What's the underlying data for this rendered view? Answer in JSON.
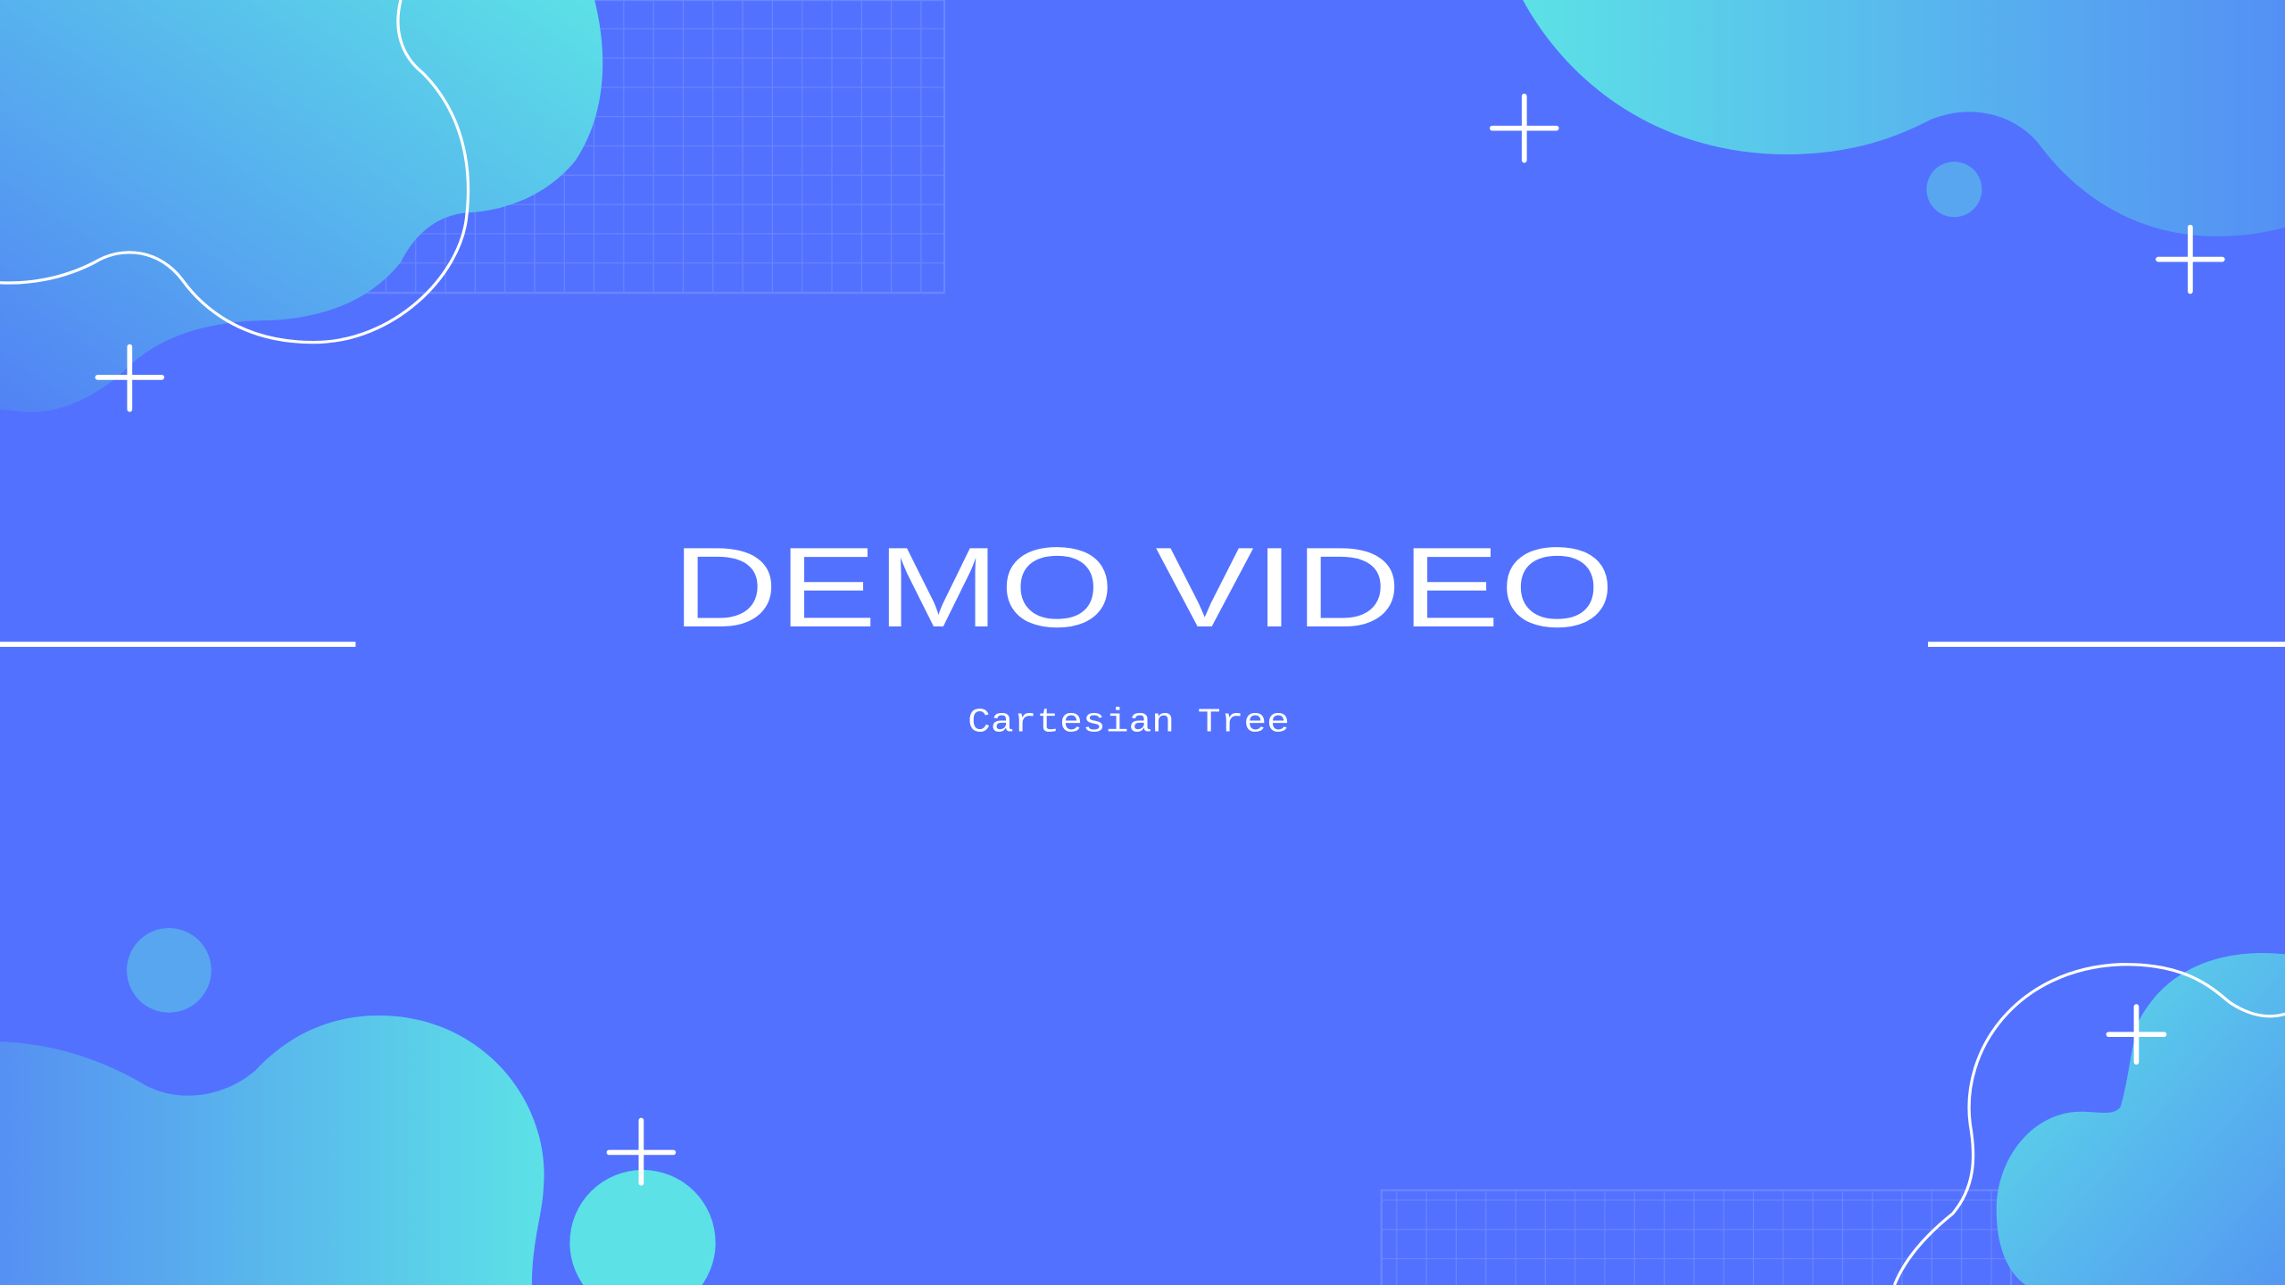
{
  "slide": {
    "title": "DEMO VIDEO",
    "subtitle": "Cartesian Tree"
  },
  "colors": {
    "background": "#5271FF",
    "blob_blue": "#5690F2",
    "blob_cyan": "#5CE1E6",
    "dot": "#58A6F0",
    "grid": "#6A86FF",
    "accent_white": "#FFFFFF"
  }
}
